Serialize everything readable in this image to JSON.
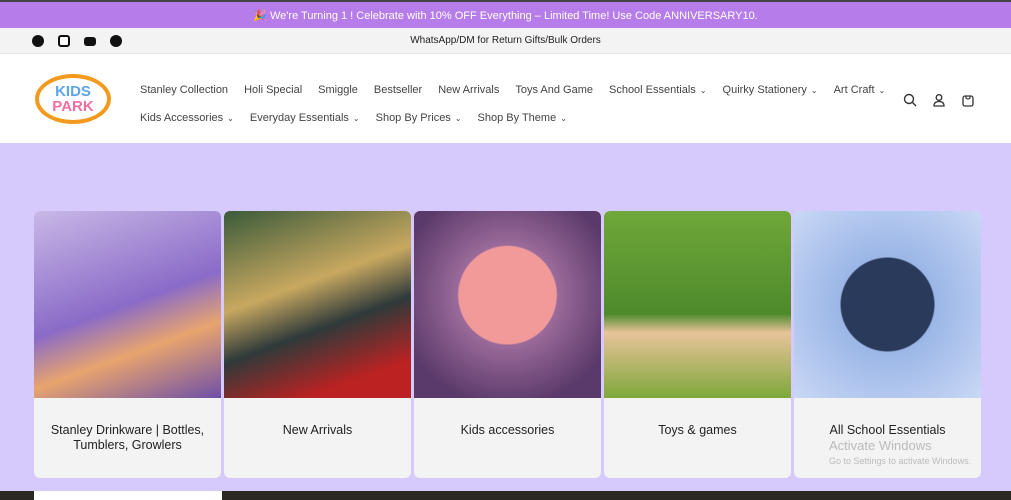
{
  "announcement": "🎉 We're Turning 1 ! Celebrate with 10% OFF Everything – Limited Time! Use Code ANNIVERSARY10.",
  "utility_message": "WhatsApp/DM for Return Gifts/Bulk Orders",
  "social": [
    "facebook-icon",
    "instagram-icon",
    "youtube-icon",
    "pinterest-icon"
  ],
  "logo": {
    "line1": "KIDS",
    "line2": "PARK"
  },
  "nav_row1": [
    {
      "label": "Stanley Collection",
      "dropdown": false
    },
    {
      "label": "Holi Special",
      "dropdown": false
    },
    {
      "label": "Smiggle",
      "dropdown": false
    },
    {
      "label": "Bestseller",
      "dropdown": false
    },
    {
      "label": "New Arrivals",
      "dropdown": false
    },
    {
      "label": "Toys And Game",
      "dropdown": false
    },
    {
      "label": "School Essentials",
      "dropdown": true
    },
    {
      "label": "Quirky Stationery",
      "dropdown": true
    },
    {
      "label": "Art Craft",
      "dropdown": true
    }
  ],
  "nav_row2": [
    {
      "label": "Kids Accessories",
      "dropdown": true
    },
    {
      "label": "Everyday Essentials",
      "dropdown": true
    },
    {
      "label": "Shop By Prices",
      "dropdown": true
    },
    {
      "label": "Shop By Theme",
      "dropdown": true
    }
  ],
  "cards": [
    {
      "title": "Stanley Drinkware | Bottles, Tumblers, Growlers"
    },
    {
      "title": "New Arrivals"
    },
    {
      "title": "Kids accessories"
    },
    {
      "title": "Toys & games"
    },
    {
      "title": "All School Essentials"
    }
  ],
  "watermark": {
    "title": "Activate Windows",
    "subtitle": "Go to Settings to activate Windows."
  },
  "colors": {
    "banner": "#b67ce9",
    "background": "#d5cafb"
  }
}
